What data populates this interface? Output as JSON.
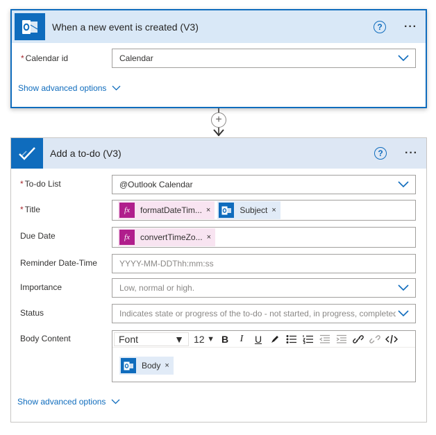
{
  "trigger": {
    "title": "When a new event is created (V3)",
    "icon": "outlook-icon",
    "help_glyph": "?",
    "more_glyph": "···",
    "calendar_label": "Calendar id",
    "required_mark": "*",
    "calendar_value": "Calendar",
    "advanced_link": "Show advanced options"
  },
  "connector_glyph": "+",
  "action": {
    "title": "Add a to-do (V3)",
    "icon": "todo-check-icon",
    "help_glyph": "?",
    "more_glyph": "···",
    "required_mark": "*",
    "todo_list_label": "To-do List",
    "todo_list_value": "@Outlook Calendar",
    "title_label": "Title",
    "title_tokens": [
      {
        "label": "formatDateTim...",
        "icon": "function-icon",
        "icon_text": "fx"
      },
      {
        "label": "Subject",
        "icon": "outlook-icon"
      }
    ],
    "due_date_label": "Due Date",
    "due_date_tokens": [
      {
        "label": "convertTimeZo...",
        "icon": "function-icon",
        "icon_text": "fx"
      }
    ],
    "reminder_label": "Reminder Date-Time",
    "reminder_placeholder": "YYYY-MM-DDThh:mm:ss",
    "importance_label": "Importance",
    "importance_placeholder": "Low, normal or high.",
    "status_label": "Status",
    "status_placeholder": "Indicates state or progress of the to-do - not started, in progress, completed.",
    "body_label": "Body Content",
    "toolbar": {
      "font": "Font",
      "size": "12",
      "bold": "B",
      "italic": "I",
      "underline": "U"
    },
    "body_tokens": [
      {
        "label": "Body",
        "icon": "outlook-icon"
      }
    ],
    "token_remove_glyph": "×",
    "advanced_link": "Show advanced options"
  },
  "colors": {
    "accent": "#0f6cbd",
    "header_bg": "#d9e8f7",
    "fx_purple": "#b01e8c",
    "required": "#a4262c"
  }
}
